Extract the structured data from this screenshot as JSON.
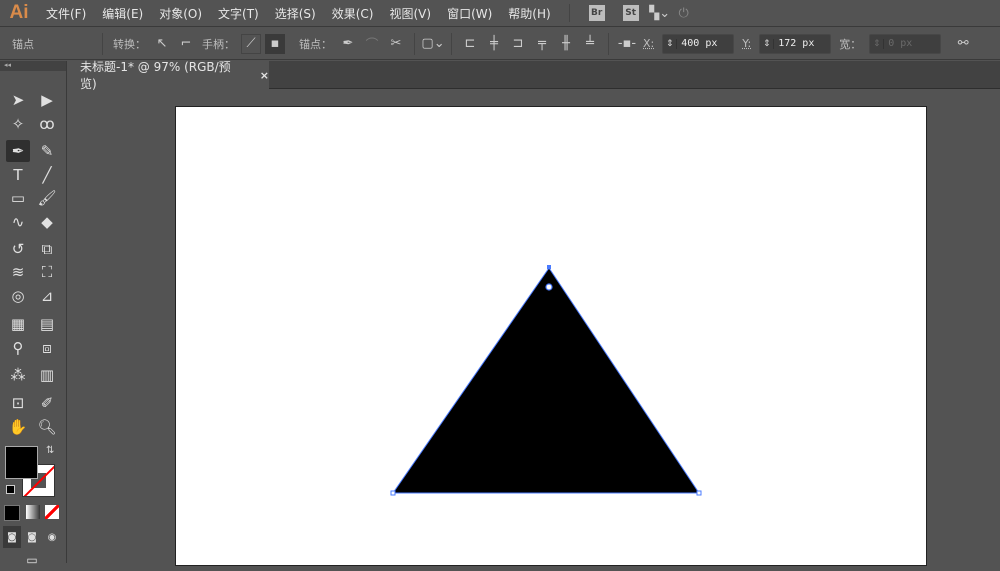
{
  "app": {
    "logo": "Ai"
  },
  "menu": [
    "文件(F)",
    "编辑(E)",
    "对象(O)",
    "文字(T)",
    "选择(S)",
    "效果(C)",
    "视图(V)",
    "窗口(W)",
    "帮助(H)"
  ],
  "menubar_badges": {
    "bridge": "Br",
    "stock": "St"
  },
  "control": {
    "selection_label": "锚点",
    "convert_label": "转换：",
    "handles_label": "手柄：",
    "anchors_label": "锚点：",
    "x_label": "X:",
    "x_value": "400 px",
    "y_label": "Y:",
    "y_value": "172 px",
    "w_label": "宽：",
    "w_value": "0 px"
  },
  "document_tab": {
    "title": "未标题-1* @ 97% (RGB/预览)",
    "close": "×"
  },
  "colors": {
    "fill": "#000000",
    "stroke": "none",
    "path_selection": "#4a7bff"
  },
  "shape": {
    "type": "triangle",
    "fill": "#000000"
  }
}
